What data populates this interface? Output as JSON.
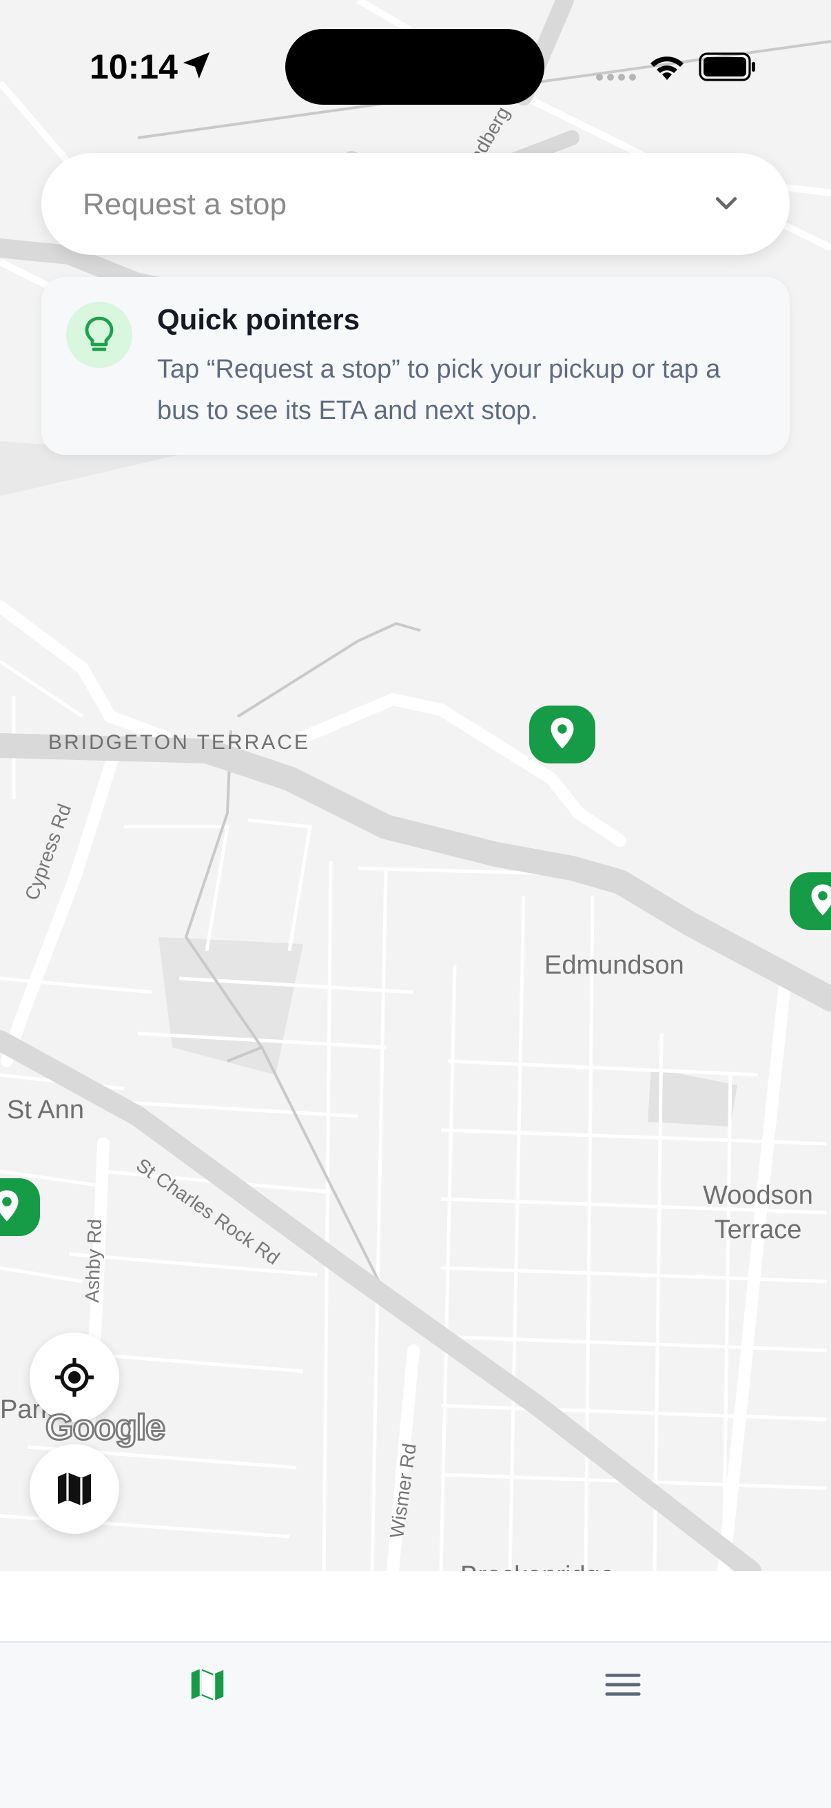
{
  "status_bar": {
    "time": "10:14"
  },
  "request_stop": {
    "placeholder": "Request a stop"
  },
  "quick_pointers": {
    "title": "Quick pointers",
    "body": "Tap “Request a stop” to pick your pickup or tap a bus to see its ETA and next stop."
  },
  "map": {
    "area_labels": {
      "bridgeton": "BRIDGETON TERRACE"
    },
    "places": {
      "edmundson": "Edmundson",
      "st_ann": "St Ann",
      "woodson": "Woodson Terrace",
      "park": "Park",
      "bottom": "Breckenridge"
    },
    "roads": {
      "cypress": "Cypress Rd",
      "st_charles": "St Charles Rock Rd",
      "ashby": "Ashby Rd",
      "wismer": "Wismer Rd",
      "ndberg": "ndberg"
    },
    "attribution": "Google"
  },
  "colors": {
    "accent": "#169b46",
    "pin": "#169b46"
  },
  "icons": {
    "status": [
      "location-arrow-icon",
      "signal-icon",
      "wifi-icon",
      "battery-icon"
    ],
    "request": "chevron-down-icon",
    "pointers": "lightbulb-icon",
    "fabs": [
      "my-location-icon",
      "map-layers-icon"
    ],
    "tabs": [
      "map-icon",
      "menu-icon"
    ]
  }
}
